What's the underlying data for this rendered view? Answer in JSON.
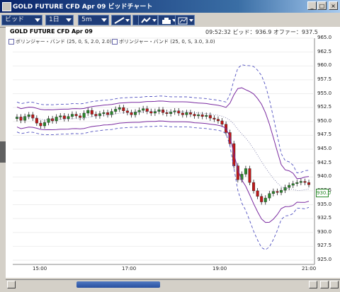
{
  "window": {
    "title": "GOLD FUTURE CFD Apr 09 ビッドチャート",
    "controls": [
      "_",
      "□",
      "×"
    ]
  },
  "toolbar": {
    "price_type": "ビッド",
    "period": "1日",
    "interval": "5m",
    "tools": [
      "draw-line-icon",
      "pin-icon",
      "indicator-icon",
      "print-icon",
      "chart-image-icon"
    ]
  },
  "chart": {
    "symbol_label": "GOLD FUTURE CFD Apr 09",
    "info": "09:52:32 ビッド：936.9 オファー：937.5",
    "legend": [
      "ボリンジャー・バンド (25, 0, S, 2.0, 2.0)",
      "ボリンジャー・バンド (25, 0, S, 3.0, 3.0)"
    ],
    "current_price_tag": "930.0",
    "colors": {
      "bb2": "#7a2aa0",
      "bb3": "#5050c0",
      "up": "#2a8a2a",
      "down": "#c01818",
      "mid": "#7070a0"
    }
  },
  "chart_data": {
    "type": "candlestick",
    "y_ticks": [
      "965.0",
      "962.5",
      "960.0",
      "957.5",
      "955.0",
      "952.5",
      "950.0",
      "947.5",
      "945.0",
      "942.5",
      "940.0",
      "937.5",
      "935.0",
      "932.5",
      "930.0",
      "927.5",
      "925.0"
    ],
    "x_ticks": [
      "15:00",
      "17:00",
      "19:00",
      "21:00"
    ],
    "ylim": [
      925.0,
      965.0
    ],
    "close_series": [
      950.8,
      950.2,
      950.9,
      951.2,
      950.6,
      949.7,
      949.2,
      949.8,
      950.5,
      950.1,
      950.8,
      951.0,
      950.5,
      950.9,
      951.3,
      951.0,
      950.7,
      951.5,
      952.0,
      951.3,
      951.0,
      951.4,
      951.6,
      951.2,
      951.8,
      952.2,
      952.5,
      951.9,
      951.6,
      951.2,
      951.7,
      952.0,
      952.3,
      951.8,
      951.5,
      951.8,
      952.1,
      951.6,
      951.4,
      951.7,
      951.9,
      951.5,
      951.2,
      951.6,
      951.3,
      951.0,
      951.2,
      950.9,
      951.1,
      950.6,
      950.4,
      950.1,
      949.5,
      948.0,
      946.0,
      942.0,
      939.5,
      940.5,
      941.5,
      939.0,
      937.5,
      936.5,
      935.5,
      936.2,
      937.0,
      937.4,
      937.2,
      937.6,
      938.1,
      938.5,
      938.8,
      939.0,
      939.2,
      939.0,
      938.6
    ]
  },
  "statusbar": {
    "scroll_position": 0.28
  }
}
